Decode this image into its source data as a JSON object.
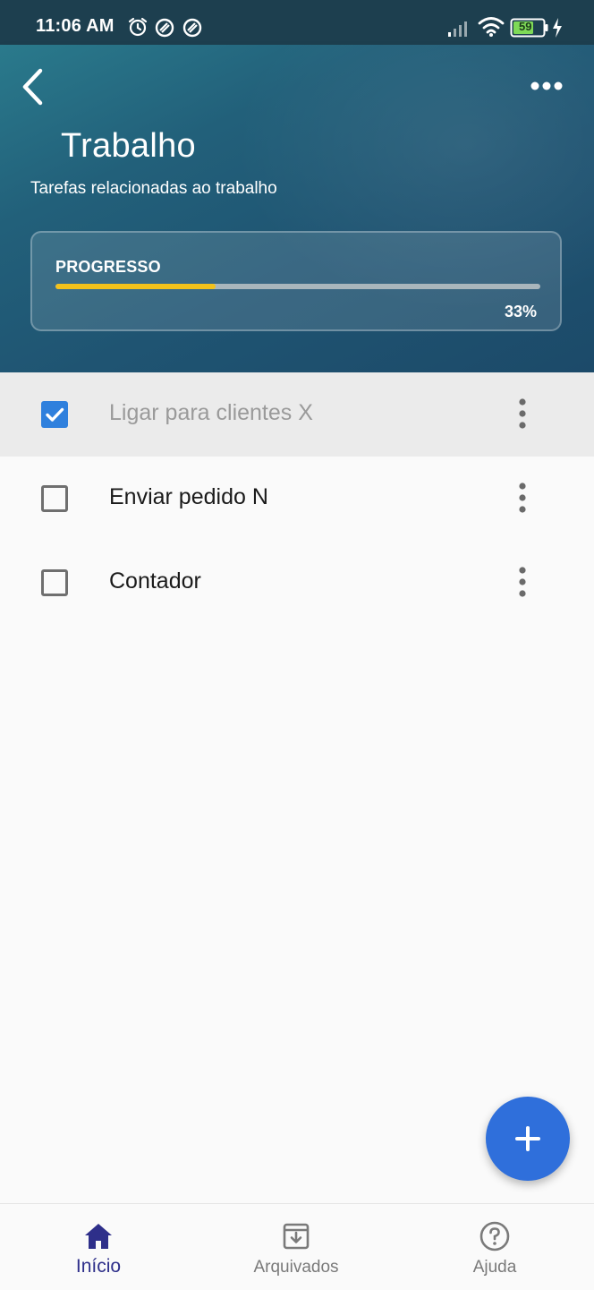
{
  "status_bar": {
    "time": "11:06 AM",
    "battery": "59",
    "icons": [
      "alarm-icon",
      "sync-icon",
      "sync-icon",
      "signal-icon",
      "wifi-icon",
      "battery-icon",
      "charging-icon"
    ]
  },
  "header": {
    "title": "Trabalho",
    "subtitle": "Tarefas relacionadas ao trabalho",
    "back_icon": "back-arrow-icon",
    "menu_icon": "more-horizontal-icon"
  },
  "progress": {
    "label": "PROGRESSO",
    "value": 0.33,
    "percent_text": "33%",
    "fill_color": "#f2c21b"
  },
  "tasks": [
    {
      "label": "Ligar para clientes X",
      "done": true
    },
    {
      "label": "Enviar pedido N",
      "done": false
    },
    {
      "label": "Contador",
      "done": false
    }
  ],
  "fab": {
    "icon": "plus-icon",
    "color": "#2f6fdb"
  },
  "bottom_nav": {
    "items": [
      {
        "label": "Início",
        "icon": "home-icon",
        "active": true
      },
      {
        "label": "Arquivados",
        "icon": "archive-icon",
        "active": false
      },
      {
        "label": "Ajuda",
        "icon": "help-icon",
        "active": false
      }
    ],
    "active_color": "#2e2f8a",
    "inactive_color": "#7a7a7a"
  },
  "colors": {
    "header_dark": "#1c4a69",
    "header_teal": "#2a7a8c",
    "checkbox_checked": "#2f80dd"
  }
}
